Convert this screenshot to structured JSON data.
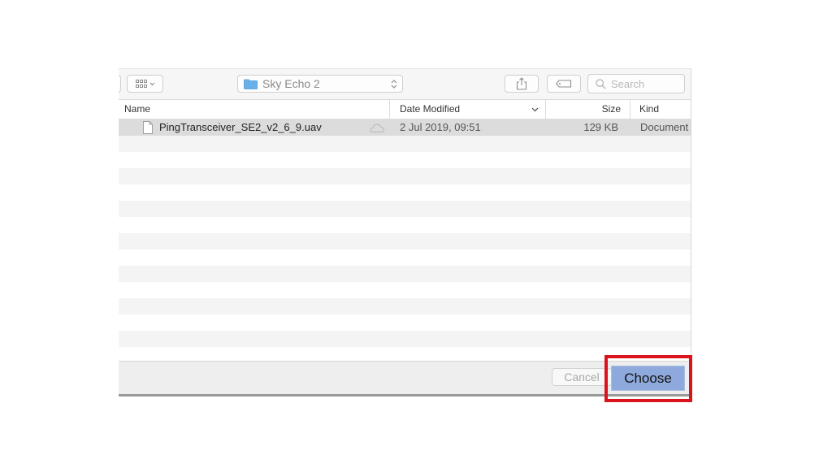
{
  "toolbar": {
    "location_label": "Sky Echo 2",
    "search_placeholder": "Search"
  },
  "columns": {
    "name": "Name",
    "date_modified": "Date Modified",
    "size": "Size",
    "kind": "Kind"
  },
  "files": [
    {
      "name": "PingTransceiver_SE2_v2_6_9.uav",
      "date_modified": "2 Jul 2019, 09:51",
      "size": "129 KB",
      "kind": "Document"
    }
  ],
  "footer": {
    "cancel_label": "Cancel",
    "choose_label": "Choose"
  },
  "icons": {
    "view": "grid-view-icon",
    "folder": "folder-icon",
    "share": "share-icon",
    "tag": "tag-icon",
    "search": "search-icon",
    "file": "document-icon",
    "cloud": "cloud-icon"
  },
  "colors": {
    "highlight_border": "#d9141c",
    "choose_button": "#8ea9db",
    "folder_icon": "#6ab0e8",
    "selected_row": "#dcdcdc"
  }
}
